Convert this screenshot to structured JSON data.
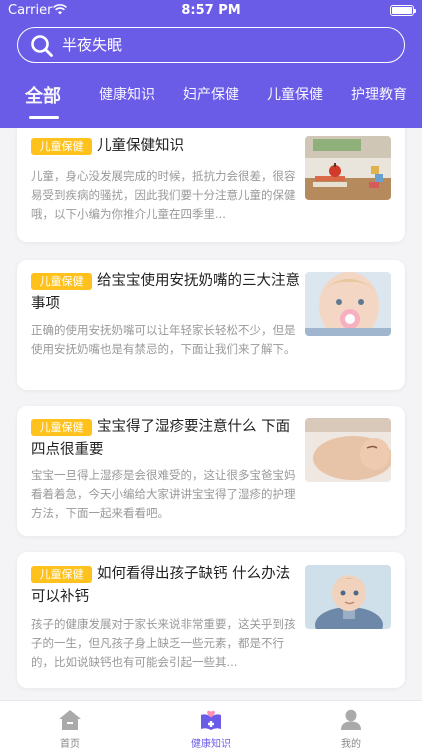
{
  "status": {
    "carrier": "Carrier",
    "time": "8:57 PM"
  },
  "search": {
    "value": "半夜失眠"
  },
  "tabs": [
    {
      "label": "全部",
      "active": true
    },
    {
      "label": "健康知识"
    },
    {
      "label": "妇产保健"
    },
    {
      "label": "儿童保健"
    },
    {
      "label": "护理教育"
    }
  ],
  "articles": [
    {
      "badge": "儿童保健",
      "title": "儿童保健知识",
      "summary": "儿童，身心没发展完成的时候，抵抗力会很差，很容易受到疾病的骚扰，因此我们要十分注意儿童的保健哦，以下小编为你推介儿童在四季里...",
      "image": "classroom-desk-photo"
    },
    {
      "badge": "儿童保健",
      "title": "给宝宝使用安抚奶嘴的三大注意事项",
      "summary": "正确的使用安抚奶嘴可以让年轻家长轻松不少，但是使用安抚奶嘴也是有禁忌的，下面让我们来了解下。",
      "image": "toddler-pacifier-photo"
    },
    {
      "badge": "儿童保健",
      "title": "宝宝得了湿疹要注意什么 下面四点很重要",
      "summary": "宝宝一旦得上湿疹是会很难受的，这让很多宝爸宝妈看着着急，今天小编给大家讲讲宝宝得了湿疹的护理方法，下面一起来看看吧。",
      "image": "sleeping-baby-photo"
    },
    {
      "badge": "儿童保健",
      "title": "如何看得出孩子缺钙 什么办法可以补钙",
      "summary": "孩子的健康发展对于家长来说非常重要，这关乎到孩子的一生，但凡孩子身上缺乏一些元素，都是不行的，比如说缺钙也有可能会引起一些其...",
      "image": "baby-sweater-photo"
    }
  ],
  "tabbar": [
    {
      "label": "首页",
      "icon": "home-icon"
    },
    {
      "label": "健康知识",
      "icon": "health-knowledge-icon",
      "active": true
    },
    {
      "label": "我的",
      "icon": "profile-icon"
    }
  ],
  "colors": {
    "primary": "#6b5ce7",
    "badge": "#ffc21c"
  }
}
